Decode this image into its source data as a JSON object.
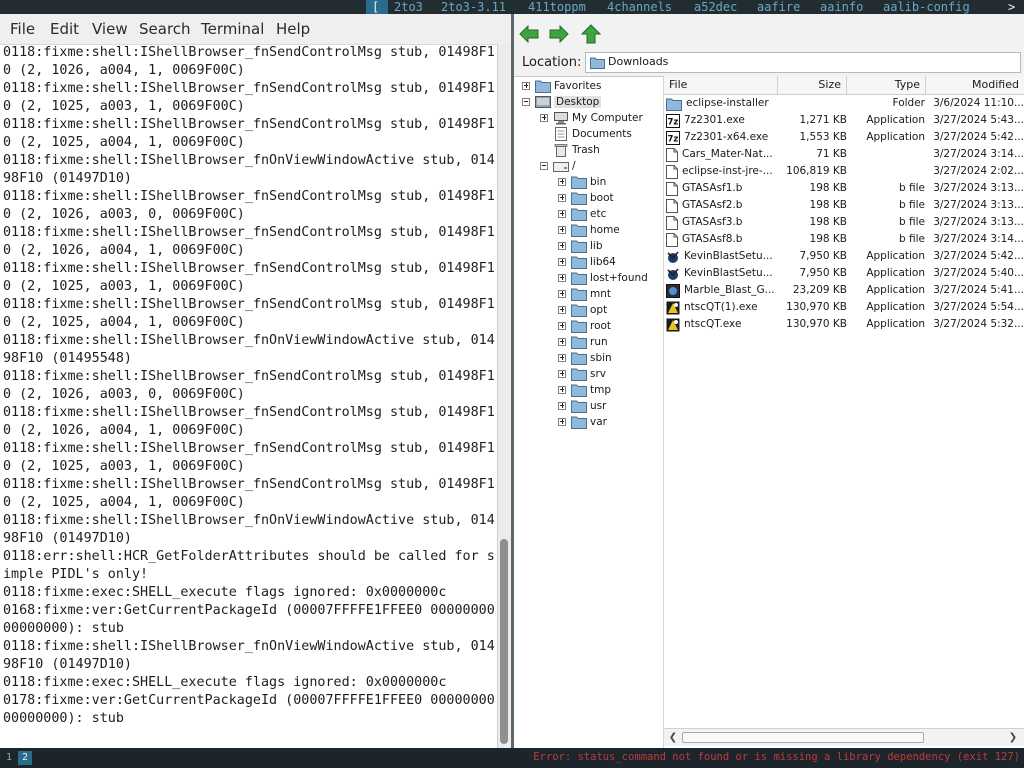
{
  "topbar": {
    "bracket": "[",
    "items": [
      "2to3",
      "2to3-3.11",
      "411toppm",
      "4channels",
      "a52dec",
      "aafire",
      "aainfo",
      "aalib-config"
    ],
    "more": ">"
  },
  "terminal": {
    "menu": [
      "File",
      "Edit",
      "View",
      "Search",
      "Terminal",
      "Help"
    ],
    "lines": [
      "0118:fixme:shell:IShellBrowser_fnSendControlMsg stub, 01498F1",
      "0 (2, 1026, a004, 1, 0069F00C)",
      "0118:fixme:shell:IShellBrowser_fnSendControlMsg stub, 01498F1",
      "0 (2, 1025, a003, 1, 0069F00C)",
      "0118:fixme:shell:IShellBrowser_fnSendControlMsg stub, 01498F1",
      "0 (2, 1025, a004, 1, 0069F00C)",
      "0118:fixme:shell:IShellBrowser_fnOnViewWindowActive stub, 014",
      "98F10 (01497D10)",
      "0118:fixme:shell:IShellBrowser_fnSendControlMsg stub, 01498F1",
      "0 (2, 1026, a003, 0, 0069F00C)",
      "0118:fixme:shell:IShellBrowser_fnSendControlMsg stub, 01498F1",
      "0 (2, 1026, a004, 1, 0069F00C)",
      "0118:fixme:shell:IShellBrowser_fnSendControlMsg stub, 01498F1",
      "0 (2, 1025, a003, 1, 0069F00C)",
      "0118:fixme:shell:IShellBrowser_fnSendControlMsg stub, 01498F1",
      "0 (2, 1025, a004, 1, 0069F00C)",
      "0118:fixme:shell:IShellBrowser_fnOnViewWindowActive stub, 014",
      "98F10 (01495548)",
      "0118:fixme:shell:IShellBrowser_fnSendControlMsg stub, 01498F1",
      "0 (2, 1026, a003, 0, 0069F00C)",
      "0118:fixme:shell:IShellBrowser_fnSendControlMsg stub, 01498F1",
      "0 (2, 1026, a004, 1, 0069F00C)",
      "0118:fixme:shell:IShellBrowser_fnSendControlMsg stub, 01498F1",
      "0 (2, 1025, a003, 1, 0069F00C)",
      "0118:fixme:shell:IShellBrowser_fnSendControlMsg stub, 01498F1",
      "0 (2, 1025, a004, 1, 0069F00C)",
      "0118:fixme:shell:IShellBrowser_fnOnViewWindowActive stub, 014",
      "98F10 (01497D10)",
      "0118:err:shell:HCR_GetFolderAttributes should be called for s",
      "imple PIDL's only!",
      "0118:fixme:exec:SHELL_execute flags ignored: 0x0000000c",
      "0168:fixme:ver:GetCurrentPackageId (00007FFFFE1FFEE0 00000000",
      "00000000): stub",
      "0118:fixme:shell:IShellBrowser_fnOnViewWindowActive stub, 014",
      "98F10 (01497D10)",
      "0118:fixme:exec:SHELL_execute flags ignored: 0x0000000c",
      "0178:fixme:ver:GetCurrentPackageId (00007FFFFE1FFEE0 00000000",
      "00000000): stub"
    ]
  },
  "filemanager": {
    "location_label": "Location:",
    "location_value": "Downloads",
    "tree": [
      {
        "label": "Favorites",
        "expander": "plus",
        "icon": "folder",
        "level": 0
      },
      {
        "label": "Desktop",
        "expander": "minus",
        "icon": "desktop",
        "level": 0,
        "selected": true
      },
      {
        "label": "My Computer",
        "expander": "plus",
        "icon": "computer",
        "level": 1
      },
      {
        "label": "Documents",
        "expander": "none",
        "icon": "documents",
        "level": 1
      },
      {
        "label": "Trash",
        "expander": "none",
        "icon": "trash",
        "level": 1
      },
      {
        "label": "/",
        "expander": "minus",
        "icon": "drive",
        "level": 1
      },
      {
        "label": "bin",
        "expander": "plus",
        "icon": "folder",
        "level": 2
      },
      {
        "label": "boot",
        "expander": "plus",
        "icon": "folder",
        "level": 2
      },
      {
        "label": "etc",
        "expander": "plus",
        "icon": "folder",
        "level": 2
      },
      {
        "label": "home",
        "expander": "plus",
        "icon": "folder",
        "level": 2
      },
      {
        "label": "lib",
        "expander": "plus",
        "icon": "folder",
        "level": 2
      },
      {
        "label": "lib64",
        "expander": "plus",
        "icon": "folder",
        "level": 2
      },
      {
        "label": "lost+found",
        "expander": "plus",
        "icon": "folder",
        "level": 2
      },
      {
        "label": "mnt",
        "expander": "plus",
        "icon": "folder",
        "level": 2
      },
      {
        "label": "opt",
        "expander": "plus",
        "icon": "folder",
        "level": 2
      },
      {
        "label": "root",
        "expander": "plus",
        "icon": "folder",
        "level": 2
      },
      {
        "label": "run",
        "expander": "plus",
        "icon": "folder",
        "level": 2
      },
      {
        "label": "sbin",
        "expander": "plus",
        "icon": "folder",
        "level": 2
      },
      {
        "label": "srv",
        "expander": "plus",
        "icon": "folder",
        "level": 2
      },
      {
        "label": "tmp",
        "expander": "plus",
        "icon": "folder",
        "level": 2
      },
      {
        "label": "usr",
        "expander": "plus",
        "icon": "folder",
        "level": 2
      },
      {
        "label": "var",
        "expander": "plus",
        "icon": "folder",
        "level": 2
      }
    ],
    "columns": {
      "name": "File",
      "size": "Size",
      "type": "Type",
      "modified": "Modified"
    },
    "files": [
      {
        "name": "eclipse-installer",
        "size": "",
        "type": "Folder",
        "modified": "3/6/2024 11:10...",
        "icon": "folder"
      },
      {
        "name": "7z2301.exe",
        "size": "1,271 KB",
        "type": "Application",
        "modified": "3/27/2024 5:43...",
        "icon": "7z"
      },
      {
        "name": "7z2301-x64.exe",
        "size": "1,553 KB",
        "type": "Application",
        "modified": "3/27/2024 5:42...",
        "icon": "7z"
      },
      {
        "name": "Cars_Mater-Nat...",
        "size": "71 KB",
        "type": "",
        "modified": "3/27/2024 3:14...",
        "icon": "file"
      },
      {
        "name": "eclipse-inst-jre-...",
        "size": "106,819 KB",
        "type": "",
        "modified": "3/27/2024 2:02...",
        "icon": "file"
      },
      {
        "name": "GTASAsf1.b",
        "size": "198 KB",
        "type": "b file",
        "modified": "3/27/2024 3:13...",
        "icon": "file"
      },
      {
        "name": "GTASAsf2.b",
        "size": "198 KB",
        "type": "b file",
        "modified": "3/27/2024 3:13...",
        "icon": "file"
      },
      {
        "name": "GTASAsf3.b",
        "size": "198 KB",
        "type": "b file",
        "modified": "3/27/2024 3:13...",
        "icon": "file"
      },
      {
        "name": "GTASAsf8.b",
        "size": "198 KB",
        "type": "b file",
        "modified": "3/27/2024 3:14...",
        "icon": "file"
      },
      {
        "name": "KevinBlastSetu...",
        "size": "7,950 KB",
        "type": "Application",
        "modified": "3/27/2024 5:42...",
        "icon": "kevin"
      },
      {
        "name": "KevinBlastSetu...",
        "size": "7,950 KB",
        "type": "Application",
        "modified": "3/27/2024 5:40...",
        "icon": "kevin"
      },
      {
        "name": "Marble_Blast_G...",
        "size": "23,209 KB",
        "type": "Application",
        "modified": "3/27/2024 5:41...",
        "icon": "marble"
      },
      {
        "name": "ntscQT(1).exe",
        "size": "130,970 KB",
        "type": "Application",
        "modified": "3/27/2024 5:54...",
        "icon": "ntsc"
      },
      {
        "name": "ntscQT.exe",
        "size": "130,970 KB",
        "type": "Application",
        "modified": "3/27/2024 5:32...",
        "icon": "ntsc"
      }
    ]
  },
  "bottombar": {
    "workspaces": [
      "1",
      "2"
    ],
    "active_workspace": "2",
    "error": "Error: status_command not found or is missing a library dependency (exit 127)"
  },
  "colors": {
    "accent": "#2a6c8c",
    "folder": "#8fb8dc",
    "nav_green": "#3fa33f",
    "error_red": "#c03a3a"
  }
}
